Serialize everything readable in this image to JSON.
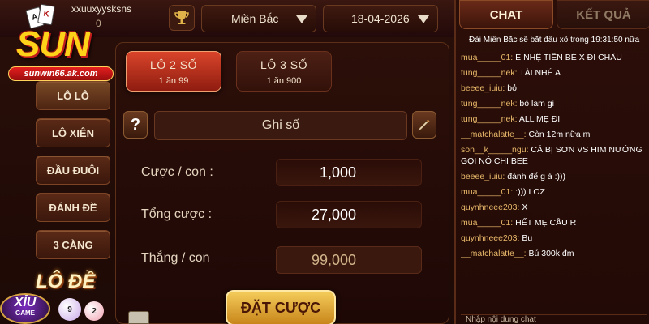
{
  "header": {
    "username": "xxuuxyysksns",
    "balance_fragment": "0",
    "region": "Miền Bắc",
    "date": "18-04-2026"
  },
  "logo": {
    "brand": "SUN",
    "url": "sunwin66.ak.com",
    "card_a": "A",
    "card_k": "K"
  },
  "sidebar": {
    "items": [
      {
        "label": "LÔ LÔ",
        "active": true
      },
      {
        "label": "LÔ XIÊN"
      },
      {
        "label": "ĐẦU ĐUÔI"
      },
      {
        "label": "ĐÁNH ĐỀ"
      },
      {
        "label": "3 CÀNG"
      }
    ],
    "lode_title": "LÔ ĐỀ",
    "xiu_label": "XỈU",
    "xiu_sub": "GAME",
    "ball_numbers": [
      "9",
      "2"
    ]
  },
  "tabs": [
    {
      "title": "LÔ 2 SỐ",
      "sub": "1 ăn 99"
    },
    {
      "title": "LÔ 3 SỐ",
      "sub": "1 ăn 900"
    }
  ],
  "form": {
    "help_label": "?",
    "numbers_placeholder": "Ghi số",
    "rows": [
      {
        "label": "Cược / con :",
        "value": "1,000"
      },
      {
        "label": "Tổng cược :",
        "value": "27,000"
      },
      {
        "label": "Thắng / con",
        "value": "99,000"
      }
    ],
    "bet_button": "ĐẶT CƯỢC"
  },
  "chat": {
    "tabs": [
      "CHAT",
      "KẾT QUẢ"
    ],
    "notice": "Đài Miền Bắc sẽ bắt đầu xổ trong 19:31:50 nữa",
    "messages": [
      {
        "user": "mua_____01:",
        "text": " E NHỆ TIỀN BÉ X ĐI CHÂU"
      },
      {
        "user": "tung_____nek:",
        "text": " TÀI NHÉ A"
      },
      {
        "user": "beeee_iuiu:",
        "text": " bỏ"
      },
      {
        "user": "tung_____nek:",
        "text": " bỏ lam gi"
      },
      {
        "user": "tung_____nek:",
        "text": " ALL MẸ ĐI"
      },
      {
        "user": "__matchalatte__:",
        "text": " Còn 12m nữa m"
      },
      {
        "user": "son__k_____ngu:",
        "text": " CÁ BỊ SƠN VS HIM NƯỚNG"
      },
      {
        "user": "",
        "text": "GỌI NÓ CHI BEE"
      },
      {
        "user": "beeee_iuiu:",
        "text": " đánh để g à :)))"
      },
      {
        "user": "mua_____01:",
        "text": " :))) LOZ"
      },
      {
        "user": "quynhneee203:",
        "text": " X"
      },
      {
        "user": "mua_____01:",
        "text": " HẾT MẸ CẦU R"
      },
      {
        "user": "quynhneee203:",
        "text": " Bu"
      },
      {
        "user": "__matchalatte__:",
        "text": " Bú 300k đm"
      }
    ],
    "input_placeholder": "Nhập nội dung chat"
  }
}
